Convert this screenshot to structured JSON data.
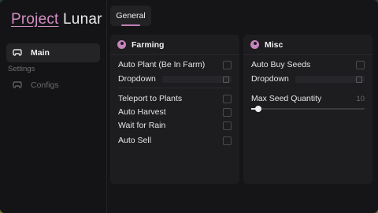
{
  "app": {
    "brand": "Project",
    "name": "Lunar"
  },
  "sidebar": {
    "items": [
      {
        "label": "Main",
        "icon": "controller-icon",
        "active": true
      }
    ],
    "section_label": "Settings",
    "settings_items": [
      {
        "label": "Configs",
        "icon": "controller-icon",
        "active": false
      }
    ]
  },
  "tabs": [
    {
      "label": "General",
      "active": true
    }
  ],
  "panels": {
    "farming": {
      "title": "Farming",
      "rows": [
        {
          "label": "Auto Plant (Be In Farm)",
          "type": "checkbox",
          "checked": false
        },
        {
          "label": "Dropdown",
          "type": "dropdown",
          "value": ""
        },
        {
          "label": "Teleport to Plants",
          "type": "checkbox",
          "checked": false
        },
        {
          "label": "Auto Harvest",
          "type": "checkbox",
          "checked": false
        },
        {
          "label": "Wait for Rain",
          "type": "checkbox",
          "checked": false
        },
        {
          "label": "Auto Sell",
          "type": "checkbox",
          "checked": false
        }
      ]
    },
    "misc": {
      "title": "Misc",
      "rows": [
        {
          "label": "Auto Buy Seeds",
          "type": "checkbox",
          "checked": false
        },
        {
          "label": "Dropdown",
          "type": "dropdown",
          "value": ""
        }
      ],
      "slider": {
        "label": "Max Seed Quantity",
        "value": "10",
        "fraction": 0.06
      }
    }
  },
  "colors": {
    "accent": "#c685bd",
    "background": "#131315",
    "panel": "#1d1d20"
  }
}
